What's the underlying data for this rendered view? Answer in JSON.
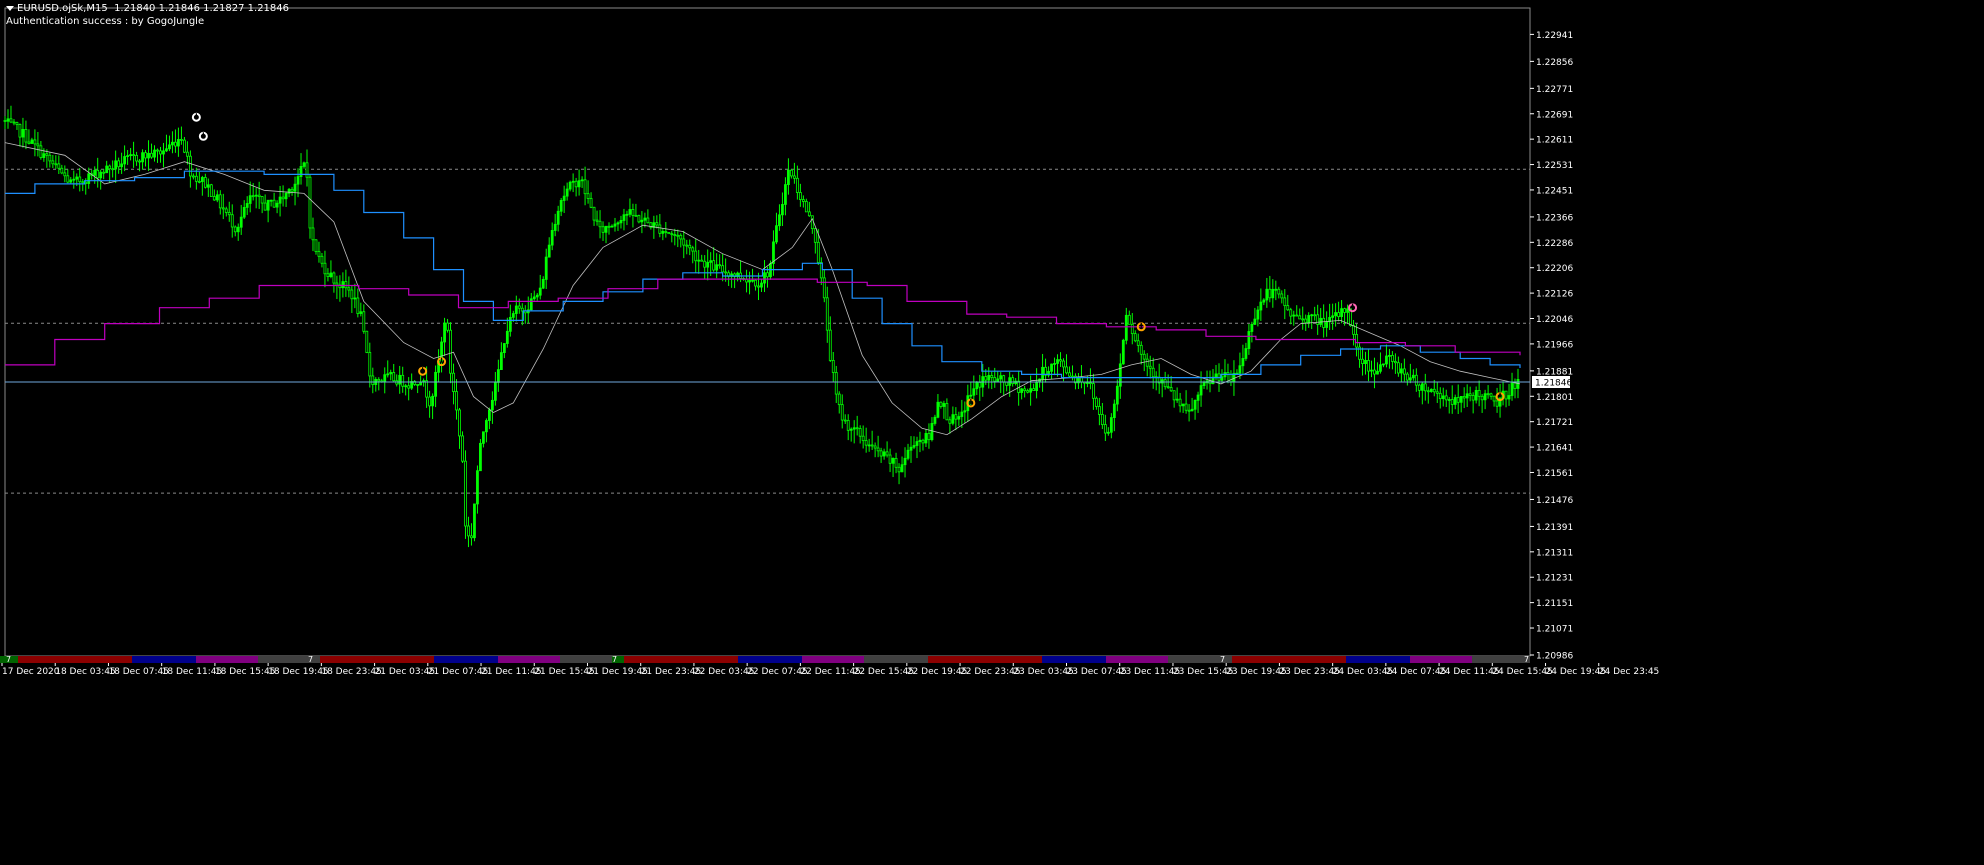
{
  "header": {
    "title": "EURUSD.ojSk,M15",
    "ohlc": "1.21840 1.21846 1.21827 1.21846",
    "status": "Authentication success : by GogoJungle"
  },
  "colors": {
    "background": "#000000",
    "candles": "#00ff00",
    "ma_fast": "#c0c0c0",
    "ma_blue": "#1e90ff",
    "ma_magenta": "#c000c0",
    "price_line": "#6fa8dc",
    "grid": "#8a8a8a",
    "axis_text": "#ffffff"
  },
  "chart_data": {
    "type": "line",
    "symbol": "EURUSD.ojSk",
    "timeframe": "M15",
    "current_price": 1.21846,
    "current_price_label": "1.21846",
    "ylim": [
      1.20986,
      1.23021
    ],
    "y_ticks": [
      "1.22941",
      "1.22856",
      "1.22771",
      "1.22691",
      "1.22611",
      "1.22531",
      "1.22451",
      "1.22366",
      "1.22286",
      "1.22206",
      "1.22126",
      "1.22046",
      "1.21966",
      "1.21881",
      "1.21801",
      "1.21721",
      "1.21641",
      "1.21561",
      "1.21476",
      "1.21391",
      "1.21311",
      "1.21231",
      "1.21151",
      "1.21071",
      "1.20986"
    ],
    "x_ticks": [
      "17 Dec 2020",
      "18 Dec 03:45",
      "18 Dec 07:45",
      "18 Dec 11:45",
      "18 Dec 15:45",
      "18 Dec 19:45",
      "18 Dec 23:45",
      "21 Dec 03:45",
      "21 Dec 07:45",
      "21 Dec 11:45",
      "21 Dec 15:45",
      "21 Dec 19:45",
      "21 Dec 23:45",
      "22 Dec 03:45",
      "22 Dec 07:45",
      "22 Dec 11:45",
      "22 Dec 15:45",
      "22 Dec 19:45",
      "22 Dec 23:45",
      "23 Dec 03:45",
      "23 Dec 07:45",
      "23 Dec 11:45",
      "23 Dec 15:45",
      "23 Dec 19:45",
      "23 Dec 23:45",
      "24 Dec 03:45",
      "24 Dec 07:45",
      "24 Dec 11:45",
      "24 Dec 15:45",
      "24 Dec 19:45",
      "24 Dec 23:45"
    ],
    "horizontal_levels": [
      1.22516,
      1.22031,
      1.21496
    ],
    "series": [
      {
        "key": "price",
        "values": [
          [
            0,
            1.2267
          ],
          [
            20,
            1.2263
          ],
          [
            45,
            1.2255
          ],
          [
            70,
            1.2247
          ],
          [
            100,
            1.2251
          ],
          [
            130,
            1.2255
          ],
          [
            160,
            1.2257
          ],
          [
            180,
            1.2262
          ],
          [
            190,
            1.225
          ],
          [
            205,
            1.2247
          ],
          [
            220,
            1.224
          ],
          [
            235,
            1.2233
          ],
          [
            250,
            1.2243
          ],
          [
            265,
            1.224
          ],
          [
            280,
            1.2242
          ],
          [
            295,
            1.2248
          ],
          [
            305,
            1.2254
          ],
          [
            310,
            1.223
          ],
          [
            320,
            1.2222
          ],
          [
            335,
            1.2216
          ],
          [
            350,
            1.2213
          ],
          [
            360,
            1.2205
          ],
          [
            370,
            1.2185
          ],
          [
            390,
            1.2186
          ],
          [
            410,
            1.2184
          ],
          [
            420,
            1.2186
          ],
          [
            430,
            1.2178
          ],
          [
            440,
            1.2194
          ],
          [
            445,
            1.2207
          ],
          [
            450,
            1.2188
          ],
          [
            455,
            1.2178
          ],
          [
            462,
            1.216
          ],
          [
            465,
            1.214
          ],
          [
            470,
            1.2133
          ],
          [
            478,
            1.216
          ],
          [
            485,
            1.2173
          ],
          [
            495,
            1.2183
          ],
          [
            505,
            1.22
          ],
          [
            515,
            1.2207
          ],
          [
            525,
            1.2208
          ],
          [
            540,
            1.2213
          ],
          [
            550,
            1.223
          ],
          [
            560,
            1.2242
          ],
          [
            570,
            1.2246
          ],
          [
            580,
            1.2249
          ],
          [
            590,
            1.224
          ],
          [
            600,
            1.2232
          ],
          [
            615,
            1.2235
          ],
          [
            625,
            1.2238
          ],
          [
            640,
            1.2236
          ],
          [
            660,
            1.2233
          ],
          [
            680,
            1.223
          ],
          [
            700,
            1.2223
          ],
          [
            720,
            1.222
          ],
          [
            740,
            1.2218
          ],
          [
            760,
            1.2216
          ],
          [
            770,
            1.222
          ],
          [
            780,
            1.2238
          ],
          [
            790,
            1.2252
          ],
          [
            795,
            1.2248
          ],
          [
            805,
            1.224
          ],
          [
            815,
            1.2232
          ],
          [
            825,
            1.221
          ],
          [
            832,
            1.219
          ],
          [
            838,
            1.2178
          ],
          [
            845,
            1.2172
          ],
          [
            860,
            1.2168
          ],
          [
            875,
            1.2163
          ],
          [
            890,
            1.216
          ],
          [
            900,
            1.2157
          ],
          [
            915,
            1.2166
          ],
          [
            930,
            1.2167
          ],
          [
            940,
            1.218
          ],
          [
            950,
            1.2173
          ],
          [
            960,
            1.2172
          ],
          [
            970,
            1.218
          ],
          [
            985,
            1.2186
          ],
          [
            1000,
            1.2185
          ],
          [
            1015,
            1.2184
          ],
          [
            1030,
            1.2181
          ],
          [
            1045,
            1.2188
          ],
          [
            1060,
            1.2191
          ],
          [
            1075,
            1.2186
          ],
          [
            1090,
            1.2185
          ],
          [
            1100,
            1.2175
          ],
          [
            1110,
            1.2168
          ],
          [
            1120,
            1.2185
          ],
          [
            1128,
            1.2207
          ],
          [
            1135,
            1.22
          ],
          [
            1145,
            1.2192
          ],
          [
            1160,
            1.2186
          ],
          [
            1175,
            1.218
          ],
          [
            1190,
            1.2174
          ],
          [
            1205,
            1.2183
          ],
          [
            1220,
            1.2187
          ],
          [
            1235,
            1.2185
          ],
          [
            1245,
            1.2192
          ],
          [
            1255,
            1.2205
          ],
          [
            1270,
            1.2213
          ],
          [
            1280,
            1.2212
          ],
          [
            1295,
            1.2205
          ],
          [
            1310,
            1.2205
          ],
          [
            1330,
            1.2203
          ],
          [
            1350,
            1.2208
          ],
          [
            1360,
            1.2193
          ],
          [
            1375,
            1.2188
          ],
          [
            1390,
            1.2192
          ],
          [
            1405,
            1.2188
          ],
          [
            1420,
            1.2184
          ],
          [
            1440,
            1.2181
          ],
          [
            1460,
            1.2178
          ],
          [
            1480,
            1.2181
          ],
          [
            1500,
            1.2178
          ],
          [
            1515,
            1.2183
          ],
          [
            1520,
            1.21846
          ]
        ]
      },
      {
        "key": "ma_fast",
        "values": [
          [
            0,
            1.226
          ],
          [
            60,
            1.2256
          ],
          [
            100,
            1.2247
          ],
          [
            140,
            1.225
          ],
          [
            180,
            1.2254
          ],
          [
            220,
            1.225
          ],
          [
            260,
            1.2245
          ],
          [
            300,
            1.2244
          ],
          [
            330,
            1.2235
          ],
          [
            360,
            1.221
          ],
          [
            400,
            1.2197
          ],
          [
            430,
            1.2192
          ],
          [
            450,
            1.2194
          ],
          [
            470,
            1.218
          ],
          [
            490,
            1.2175
          ],
          [
            510,
            1.2178
          ],
          [
            540,
            1.2195
          ],
          [
            570,
            1.2215
          ],
          [
            600,
            1.2227
          ],
          [
            640,
            1.2234
          ],
          [
            680,
            1.2232
          ],
          [
            720,
            1.2225
          ],
          [
            760,
            1.222
          ],
          [
            790,
            1.2227
          ],
          [
            810,
            1.2236
          ],
          [
            830,
            1.222
          ],
          [
            860,
            1.2193
          ],
          [
            890,
            1.2178
          ],
          [
            920,
            1.217
          ],
          [
            945,
            1.2168
          ],
          [
            970,
            1.2173
          ],
          [
            1000,
            1.218
          ],
          [
            1030,
            1.2185
          ],
          [
            1070,
            1.2186
          ],
          [
            1100,
            1.2187
          ],
          [
            1130,
            1.219
          ],
          [
            1160,
            1.2192
          ],
          [
            1190,
            1.2187
          ],
          [
            1220,
            1.2184
          ],
          [
            1250,
            1.2188
          ],
          [
            1280,
            1.2198
          ],
          [
            1300,
            1.2203
          ],
          [
            1340,
            1.2204
          ],
          [
            1370,
            1.22
          ],
          [
            1400,
            1.2196
          ],
          [
            1430,
            1.2191
          ],
          [
            1460,
            1.2188
          ],
          [
            1490,
            1.2186
          ],
          [
            1520,
            1.2184
          ]
        ]
      },
      {
        "key": "ma_blue",
        "values": [
          [
            0,
            1.2244
          ],
          [
            30,
            1.2247
          ],
          [
            80,
            1.2248
          ],
          [
            130,
            1.2249
          ],
          [
            180,
            1.2251
          ],
          [
            230,
            1.2251
          ],
          [
            260,
            1.225
          ],
          [
            300,
            1.225
          ],
          [
            330,
            1.2245
          ],
          [
            360,
            1.2238
          ],
          [
            400,
            1.223
          ],
          [
            430,
            1.222
          ],
          [
            460,
            1.221
          ],
          [
            490,
            1.2204
          ],
          [
            520,
            1.2207
          ],
          [
            560,
            1.221
          ],
          [
            600,
            1.2213
          ],
          [
            640,
            1.2217
          ],
          [
            680,
            1.2219
          ],
          [
            720,
            1.2218
          ],
          [
            760,
            1.222
          ],
          [
            800,
            1.2222
          ],
          [
            820,
            1.222
          ],
          [
            850,
            1.2211
          ],
          [
            880,
            1.2203
          ],
          [
            910,
            1.2196
          ],
          [
            940,
            1.2191
          ],
          [
            980,
            1.2188
          ],
          [
            1020,
            1.2187
          ],
          [
            1060,
            1.2186
          ],
          [
            1100,
            1.2186
          ],
          [
            1140,
            1.2186
          ],
          [
            1180,
            1.2186
          ],
          [
            1220,
            1.2187
          ],
          [
            1260,
            1.219
          ],
          [
            1300,
            1.2193
          ],
          [
            1340,
            1.2195
          ],
          [
            1380,
            1.2196
          ],
          [
            1420,
            1.2194
          ],
          [
            1460,
            1.2192
          ],
          [
            1490,
            1.219
          ],
          [
            1520,
            1.2189
          ]
        ]
      },
      {
        "key": "ma_magenta",
        "values": [
          [
            0,
            1.219
          ],
          [
            50,
            1.2198
          ],
          [
            100,
            1.2203
          ],
          [
            155,
            1.2208
          ],
          [
            205,
            1.2211
          ],
          [
            255,
            1.2215
          ],
          [
            305,
            1.2215
          ],
          [
            355,
            1.2214
          ],
          [
            405,
            1.2212
          ],
          [
            455,
            1.2208
          ],
          [
            505,
            1.221
          ],
          [
            555,
            1.2211
          ],
          [
            605,
            1.2214
          ],
          [
            655,
            1.2217
          ],
          [
            705,
            1.2217
          ],
          [
            755,
            1.2217
          ],
          [
            815,
            1.2216
          ],
          [
            865,
            1.2215
          ],
          [
            905,
            1.221
          ],
          [
            965,
            1.2206
          ],
          [
            1005,
            1.2205
          ],
          [
            1055,
            1.2203
          ],
          [
            1105,
            1.2202
          ],
          [
            1155,
            1.2201
          ],
          [
            1205,
            1.2199
          ],
          [
            1255,
            1.2198
          ],
          [
            1305,
            1.2198
          ],
          [
            1355,
            1.2197
          ],
          [
            1405,
            1.2196
          ],
          [
            1455,
            1.2194
          ],
          [
            1520,
            1.2193
          ]
        ]
      }
    ],
    "markers": [
      {
        "x": 192,
        "y": 1.2268,
        "color": "#ffffff"
      },
      {
        "x": 199,
        "y": 1.2262,
        "color": "#ffffff"
      },
      {
        "x": 419,
        "y": 1.2188,
        "color": "#ffa500"
      },
      {
        "x": 438,
        "y": 1.2191,
        "color": "#ffa500"
      },
      {
        "x": 969,
        "y": 1.2178,
        "color": "#ffa500"
      },
      {
        "x": 1140,
        "y": 1.2202,
        "color": "#ffa500"
      },
      {
        "x": 1352,
        "y": 1.2208,
        "color": "#ff69b4"
      },
      {
        "x": 1500,
        "y": 1.218,
        "color": "#ffa500"
      }
    ],
    "session_bar": {
      "segments": [
        {
          "from": 0,
          "to": 18,
          "color": "#006400"
        },
        {
          "from": 18,
          "to": 132,
          "color": "#8b0000"
        },
        {
          "from": 132,
          "to": 196,
          "color": "#00008b"
        },
        {
          "from": 196,
          "to": 258,
          "color": "#800080"
        },
        {
          "from": 258,
          "to": 320,
          "color": "#404040"
        },
        {
          "from": 320,
          "to": 434,
          "color": "#8b0000"
        },
        {
          "from": 434,
          "to": 498,
          "color": "#00008b"
        },
        {
          "from": 498,
          "to": 560,
          "color": "#800080"
        },
        {
          "from": 560,
          "to": 612,
          "color": "#404040"
        },
        {
          "from": 612,
          "to": 624,
          "color": "#006400"
        },
        {
          "from": 624,
          "to": 738,
          "color": "#8b0000"
        },
        {
          "from": 738,
          "to": 802,
          "color": "#00008b"
        },
        {
          "from": 802,
          "to": 864,
          "color": "#800080"
        },
        {
          "from": 864,
          "to": 928,
          "color": "#404040"
        },
        {
          "from": 928,
          "to": 1042,
          "color": "#8b0000"
        },
        {
          "from": 1042,
          "to": 1106,
          "color": "#00008b"
        },
        {
          "from": 1106,
          "to": 1168,
          "color": "#800080"
        },
        {
          "from": 1168,
          "to": 1232,
          "color": "#404040"
        },
        {
          "from": 1232,
          "to": 1346,
          "color": "#8b0000"
        },
        {
          "from": 1346,
          "to": 1410,
          "color": "#00008b"
        },
        {
          "from": 1410,
          "to": 1472,
          "color": "#800080"
        },
        {
          "from": 1472,
          "to": 1530,
          "color": "#404040"
        }
      ],
      "labels": [
        {
          "x": 6,
          "text": "7"
        },
        {
          "x": 308,
          "text": "7"
        },
        {
          "x": 612,
          "text": "7"
        },
        {
          "x": 1220,
          "text": "7"
        },
        {
          "x": 1524,
          "text": "7"
        }
      ]
    }
  }
}
